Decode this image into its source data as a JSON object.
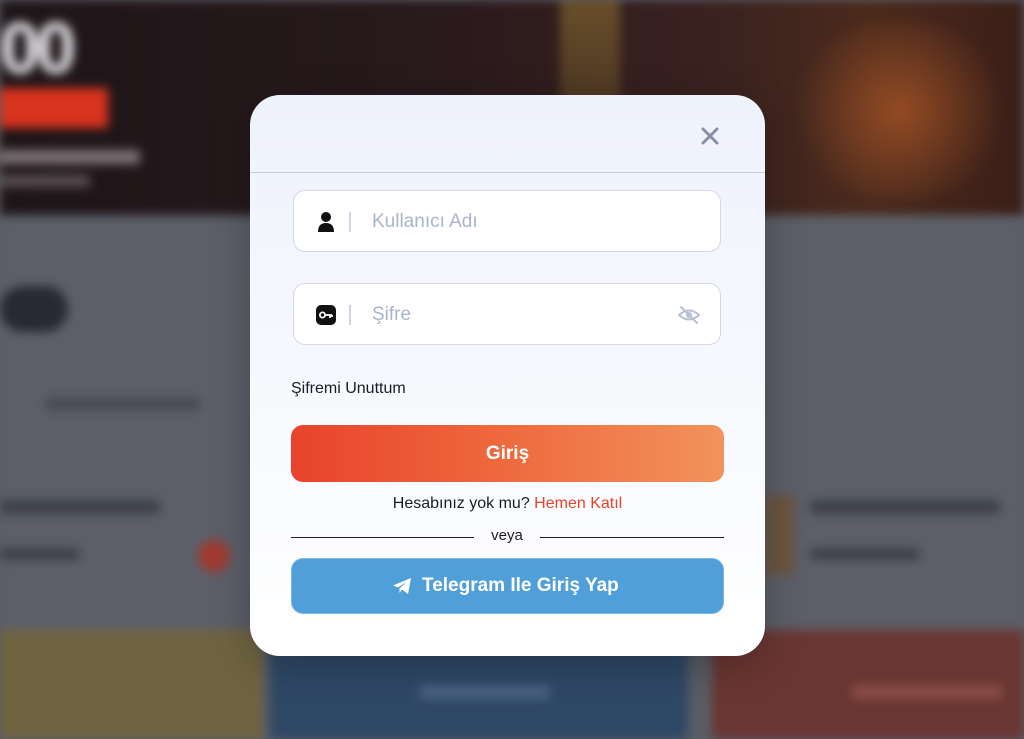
{
  "background": {
    "amount_fragment": "00"
  },
  "login_modal": {
    "username_placeholder": "Kullanıcı Adı",
    "password_placeholder": "Şifre",
    "forgot_password": "Şifremi Unuttum",
    "login_button": "Giriş",
    "no_account_text": "Hesabınız yok mu?",
    "signup_link": "Hemen Katıl",
    "divider_text": "veya",
    "telegram_button": "Telegram Ile Giriş Yap",
    "icons": {
      "close": "close-icon",
      "user": "user-icon",
      "key": "key-icon",
      "eye": "eye-off-icon",
      "telegram": "telegram-icon"
    }
  },
  "colors": {
    "accent_orange": "#e8432b",
    "telegram_blue": "#519fd8",
    "placeholder": "#a9b4cf"
  }
}
